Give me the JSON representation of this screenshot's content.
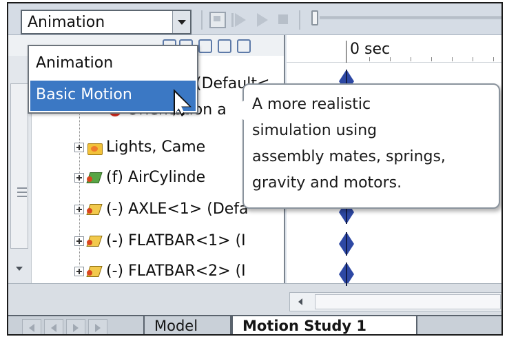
{
  "toolbar": {
    "study_type_value": "Animation"
  },
  "dropdown": {
    "options": [
      "Animation",
      "Basic Motion"
    ],
    "highlighted": "Basic Motion"
  },
  "tree": {
    "items": [
      {
        "label": "(Default<",
        "icon": "assembly-icon"
      },
      {
        "label": "Orientation a",
        "icon": "orientation-icon"
      },
      {
        "label": "Lights, Came",
        "icon": "lights-cameras-folder-icon"
      },
      {
        "label": "(f) AirCylinde",
        "icon": "assembly-icon"
      },
      {
        "label": "(-) AXLE<1> (Defa",
        "icon": "part-icon"
      },
      {
        "label": "(-) FLATBAR<1> (I",
        "icon": "part-icon"
      },
      {
        "label": "(-) FLATBAR<2> (I",
        "icon": "part-icon"
      }
    ]
  },
  "timeline": {
    "time_label": "0 sec"
  },
  "tooltip": {
    "text": "A more realistic\nsimulation using\nassembly mates, springs,\ngravity and motors."
  },
  "tabs": [
    {
      "label": "Model",
      "active": false
    },
    {
      "label": "Motion Study 1",
      "active": true
    }
  ],
  "colors": {
    "highlight": "#3b78c4",
    "keyframe": "#2d48a4"
  }
}
